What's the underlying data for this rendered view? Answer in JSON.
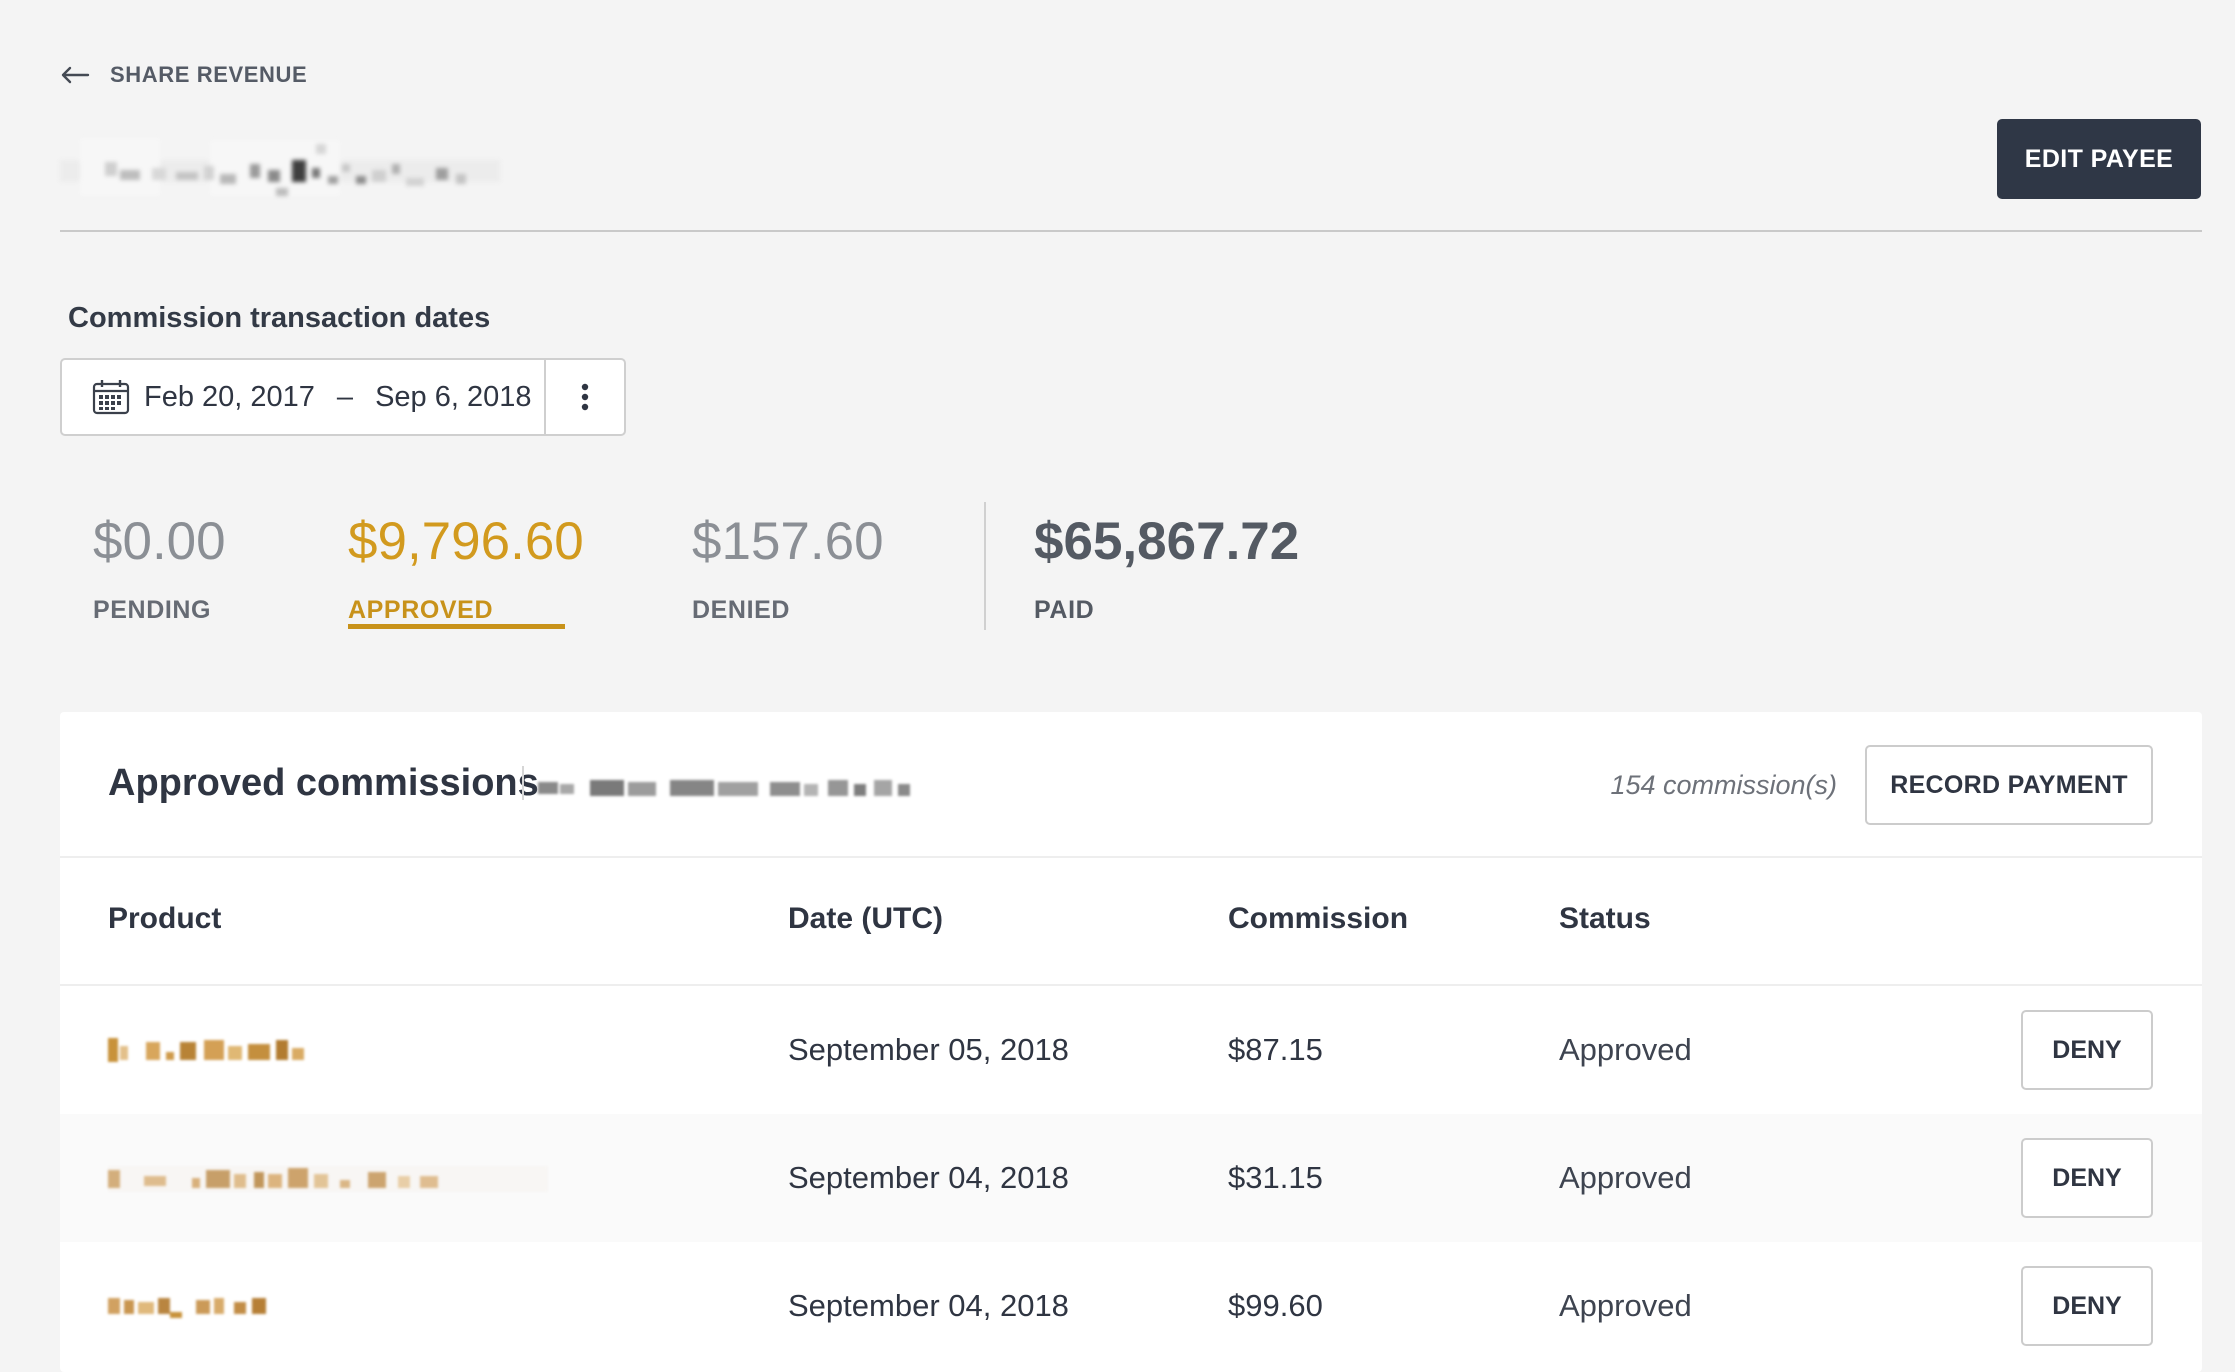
{
  "header": {
    "back_label": "SHARE REVENUE",
    "edit_button": "EDIT PAYEE"
  },
  "date_filter": {
    "title": "Commission transaction dates",
    "start": "Feb 20, 2017",
    "separator": "–",
    "end": "Sep 6, 2018"
  },
  "summary": {
    "pending": {
      "amount": "$0.00",
      "label": "PENDING"
    },
    "approved": {
      "amount": "$9,796.60",
      "label": "APPROVED"
    },
    "denied": {
      "amount": "$157.60",
      "label": "DENIED"
    },
    "paid": {
      "amount": "$65,867.72",
      "label": "PAID"
    },
    "active_tab": "approved"
  },
  "commissions": {
    "title": "Approved commissions",
    "count": "154 commission(s)",
    "record_button": "RECORD PAYMENT",
    "columns": {
      "product": "Product",
      "date": "Date (UTC)",
      "commission": "Commission",
      "status": "Status"
    },
    "rows": [
      {
        "date": "September 05, 2018",
        "amount": "$87.15",
        "status": "Approved",
        "action": "DENY"
      },
      {
        "date": "September 04, 2018",
        "amount": "$31.15",
        "status": "Approved",
        "action": "DENY"
      },
      {
        "date": "September 04, 2018",
        "amount": "$99.60",
        "status": "Approved",
        "action": "DENY"
      }
    ]
  },
  "colors": {
    "accent": "#c8921a",
    "primary_button": "#2f3746",
    "background": "#f4f4f4"
  },
  "icons": {
    "back": "arrow-left-icon",
    "calendar": "calendar-icon",
    "menu": "kebab-menu-icon"
  }
}
